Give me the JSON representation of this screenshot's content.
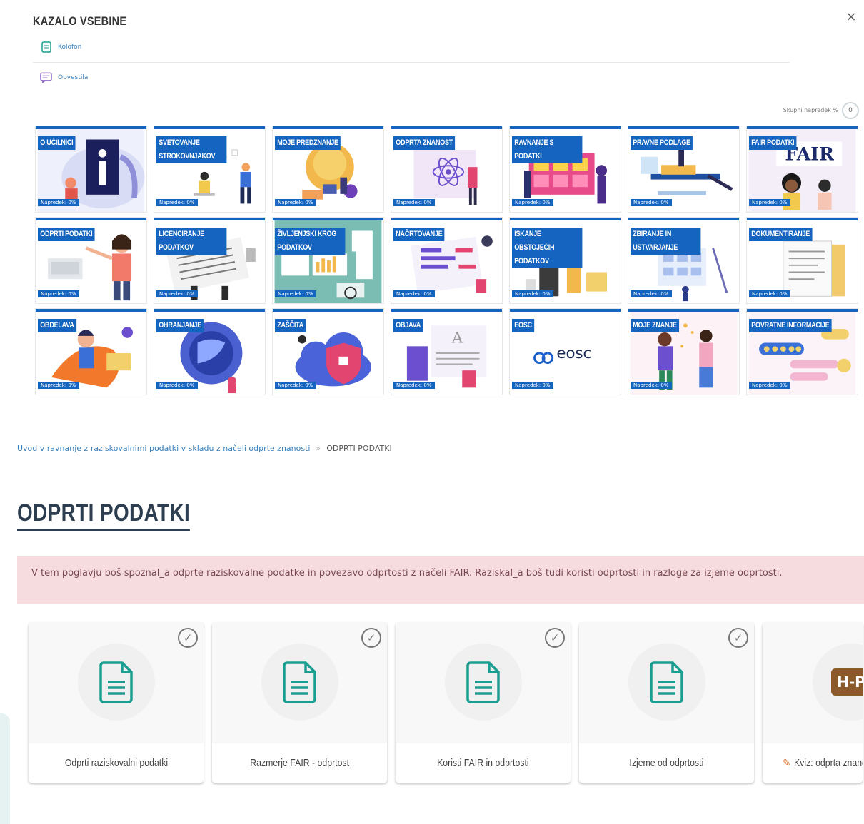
{
  "toc": {
    "title": "KAZALO VSEBINE",
    "close_label": "×",
    "links": [
      {
        "label": "Kolofon",
        "icon": "document-icon"
      },
      {
        "label": "Obvestila",
        "icon": "chat-icon"
      }
    ],
    "progress_label": "Skupni napredek %",
    "progress_value": "0",
    "tiles": [
      {
        "label": "O UČILNICI",
        "progress": "Napredek: 0%"
      },
      {
        "label": "SVETOVANJE STROKOVNJAKOV",
        "progress": "Napredek: 0%"
      },
      {
        "label": "MOJE PREDZNANJE",
        "progress": "Napredek: 0%"
      },
      {
        "label": "ODPRTA ZNANOST",
        "progress": "Napredek: 0%"
      },
      {
        "label": "RAVNANJE S PODATKI",
        "progress": "Napredek: 0%"
      },
      {
        "label": "PRAVNE PODLAGE",
        "progress": "Napredek: 0%"
      },
      {
        "label": "FAIR PODATKI",
        "progress": "Napredek: 0%"
      },
      {
        "label": "ODPRTI PODATKI",
        "progress": "Napredek: 0%"
      },
      {
        "label": "LICENCIRANJE PODATKOV",
        "progress": "Napredek: 0%"
      },
      {
        "label": "ŽIVLJENJSKI KROG PODATKOV",
        "progress": "Napredek: 0%"
      },
      {
        "label": "NAČRTOVANJE",
        "progress": "Napredek: 0%"
      },
      {
        "label": "ISKANJE OBSTOJEČIH PODATKOV",
        "progress": "Napredek: 0%"
      },
      {
        "label": "ZBIRANJE IN USTVARJANJE",
        "progress": "Napredek: 0%"
      },
      {
        "label": "DOKUMENTIRANJE",
        "progress": "Napredek: 0%"
      },
      {
        "label": "OBDELAVA",
        "progress": "Napredek: 0%"
      },
      {
        "label": "OHRANJANJE",
        "progress": "Napredek: 0%"
      },
      {
        "label": "ZAŠČITA",
        "progress": "Napredek: 0%"
      },
      {
        "label": "OBJAVA",
        "progress": "Napredek: 0%"
      },
      {
        "label": "EOSC",
        "progress": "Napredek: 0%"
      },
      {
        "label": "MOJE ZNANJE",
        "progress": "Napredek: 0%"
      },
      {
        "label": "POVRATNE INFORMACIJE",
        "progress": "Napredek: 0%"
      }
    ],
    "eosc_logo_text": "eosc",
    "fair_art_text": "FAIR"
  },
  "breadcrumb": {
    "parent": "Uvod v ravnanje z raziskovalnimi podatki v skladu z načeli odprte znanosti",
    "separator": "»",
    "current": "ODPRTI PODATKI"
  },
  "page": {
    "title": "ODPRTI PODATKI",
    "intro": "V tem poglavju boš spoznal_a odprte raziskovalne podatke in povezavo odprtosti z načeli FAIR. Raziskal_a boš tudi koristi odprtosti in razloge za izjeme odprtosti."
  },
  "cards": [
    {
      "title": "Odprti raziskovalni podatki",
      "icon": "document-icon"
    },
    {
      "title": "Razmerje FAIR - odprtost",
      "icon": "document-icon"
    },
    {
      "title": "Koristi FAIR in odprtosti",
      "icon": "document-icon"
    },
    {
      "title": "Izjeme od odprtosti",
      "icon": "document-icon"
    },
    {
      "title": "Kviz: odprta znanost",
      "icon": "h5p-icon",
      "badge": "H-P"
    }
  ],
  "colors": {
    "accent_blue": "#1565c0",
    "teal": "#1a9e8f",
    "alert_bg": "#f7dcdf",
    "link": "#3a7fb8"
  }
}
